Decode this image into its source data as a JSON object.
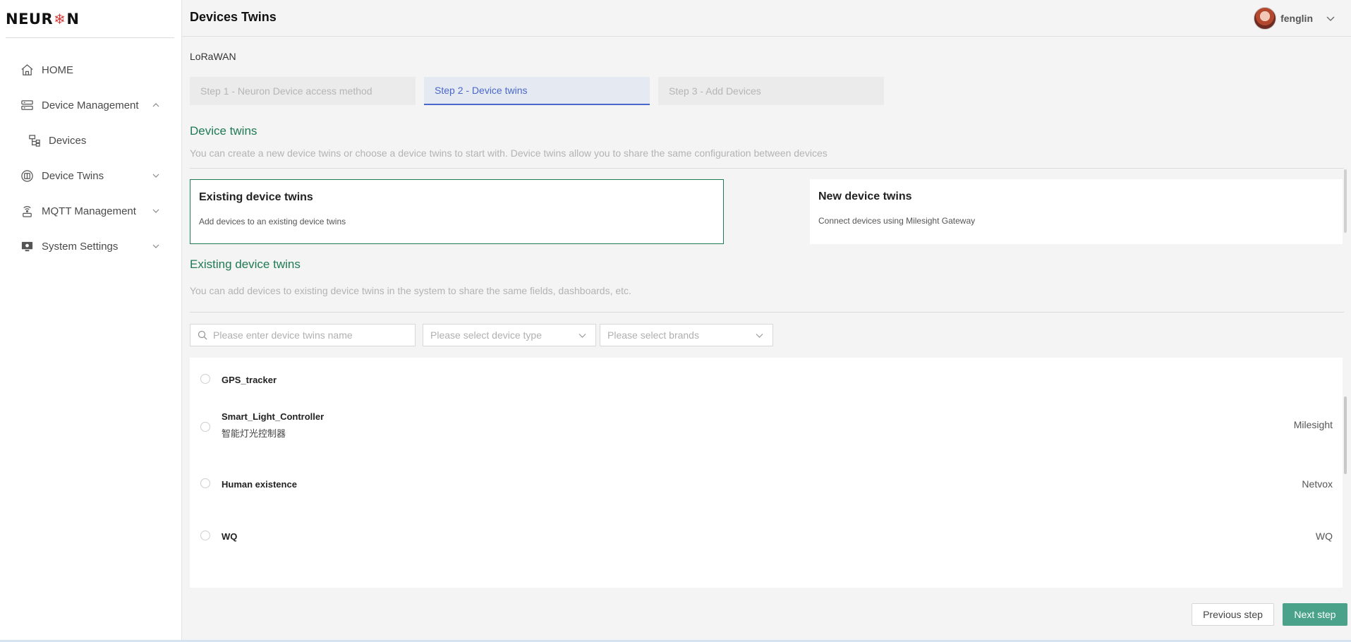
{
  "app": {
    "logo_text_left": "NEUR",
    "logo_text_right": "N"
  },
  "sidebar": {
    "items": [
      {
        "label": "HOME",
        "icon": "home-icon"
      },
      {
        "label": "Device Management",
        "icon": "server-icon",
        "expanded": true
      },
      {
        "label": "Devices",
        "icon": "devices-icon"
      },
      {
        "label": "Device Twins",
        "icon": "twins-icon"
      },
      {
        "label": "MQTT Management",
        "icon": "antenna-icon"
      },
      {
        "label": "System Settings",
        "icon": "monitor-settings-icon"
      }
    ]
  },
  "header": {
    "title": "Devices Twins",
    "username": "fenglin"
  },
  "main": {
    "breadcrumb": "LoRaWAN",
    "steps": [
      {
        "label": "Step 1 - Neuron Device access method",
        "active": false
      },
      {
        "label": "Step 2 - Device twins",
        "active": true
      },
      {
        "label": "Step 3 - Add Devices",
        "active": false
      }
    ],
    "section_title": "Device twins",
    "section_desc": "You can create a new device twins or choose a device twins to start with. Device twins allow you to share the same configuration between devices",
    "cards": [
      {
        "title": "Existing device twins",
        "desc": "Add devices to an existing device twins",
        "selected": true
      },
      {
        "title": "New device twins",
        "desc": "Connect devices using Milesight Gateway",
        "selected": false
      }
    ],
    "existing_title": "Existing device twins",
    "existing_desc": "You can add devices to existing device twins in the system to share the same fields, dashboards, etc.",
    "filters": {
      "search_placeholder": "Please enter device twins name",
      "type_placeholder": "Please select device type",
      "brand_placeholder": "Please select brands"
    },
    "rows": [
      {
        "name": "GPS_tracker",
        "sub": "",
        "brand": ""
      },
      {
        "name": "Smart_Light_Controller",
        "sub": "智能灯光控制器",
        "brand": "Milesight"
      },
      {
        "name": "Human existence",
        "sub": "",
        "brand": "Netvox"
      },
      {
        "name": "WQ",
        "sub": "",
        "brand": "WQ"
      }
    ],
    "buttons": {
      "prev": "Previous step",
      "next": "Next step"
    }
  },
  "colors": {
    "accent_green": "#1f7a55",
    "active_step_blue": "#4a68c9",
    "next_button": "#4aa28a"
  }
}
